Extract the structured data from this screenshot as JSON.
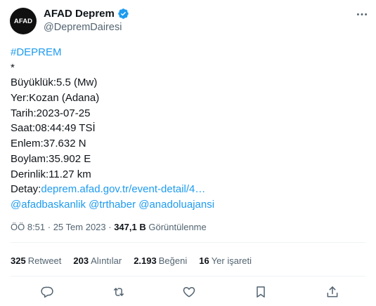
{
  "author": {
    "avatar_text": "AFAD",
    "display_name": "AFAD Deprem",
    "handle": "@DepremDairesi",
    "verified_icon": "verified-badge-icon",
    "more_icon": "more-options-icon"
  },
  "tweet": {
    "hashtag": "#DEPREM",
    "asterisk": "*",
    "magnitude": "Büyüklük:5.5 (Mw)",
    "location": "Yer:Kozan (Adana)",
    "date": "Tarih:2023-07-25",
    "time": "Saat:08:44:49 TSİ",
    "latitude": "Enlem:37.632 N",
    "longitude": "Boylam:35.902 E",
    "depth": "Derinlik:11.27 km",
    "detail_label": "Detay:",
    "detail_link": "deprem.afad.gov.tr/event-detail/4…",
    "mention_1": "@afadbaskanlik",
    "mention_2": "@trthaber",
    "mention_3": "@anadoluajansi"
  },
  "meta": {
    "time": "ÖÖ 8:51",
    "sep1": " · ",
    "date": "25 Tem 2023",
    "sep2": " · ",
    "views_count": "347,1 B",
    "views_label": " Görüntülenme"
  },
  "stats": {
    "retweets_count": "325",
    "retweets_label": "Retweet",
    "quotes_count": "203",
    "quotes_label": "Alıntılar",
    "likes_count": "2.193",
    "likes_label": "Beğeni",
    "bookmarks_count": "16",
    "bookmarks_label": "Yer işareti"
  },
  "actions": {
    "reply_icon": "reply-icon",
    "retweet_icon": "retweet-icon",
    "like_icon": "like-heart-icon",
    "bookmark_icon": "bookmark-icon",
    "share_icon": "share-icon"
  },
  "colors": {
    "link": "#1d9bf0",
    "text": "#0f1419",
    "muted": "#536471",
    "divider": "#eff3f4",
    "avatar_bg": "#101010"
  }
}
